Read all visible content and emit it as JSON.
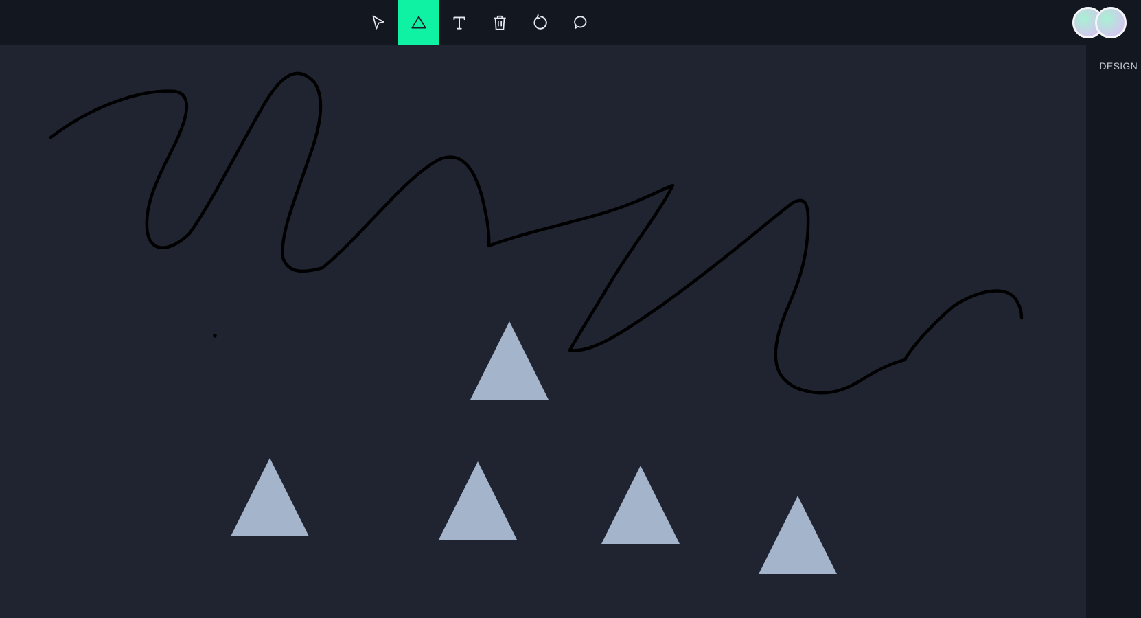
{
  "toolbar": {
    "active_color": "#0ff2a3",
    "tools": [
      {
        "icon": "cursor-arrow-icon",
        "active": false
      },
      {
        "icon": "triangle-icon",
        "active": true
      },
      {
        "icon": "text-icon",
        "active": false
      },
      {
        "icon": "trash-icon",
        "active": false
      },
      {
        "icon": "refresh-icon",
        "active": false
      },
      {
        "icon": "comment-icon",
        "active": false
      }
    ]
  },
  "users": {
    "avatars": [
      "avatar",
      "avatar"
    ]
  },
  "panel": {
    "design_label": "DESIGN"
  },
  "canvas": {
    "background": "#1f2430",
    "shape_fill": "#a4b5cb",
    "stroke_color": "#000000"
  }
}
